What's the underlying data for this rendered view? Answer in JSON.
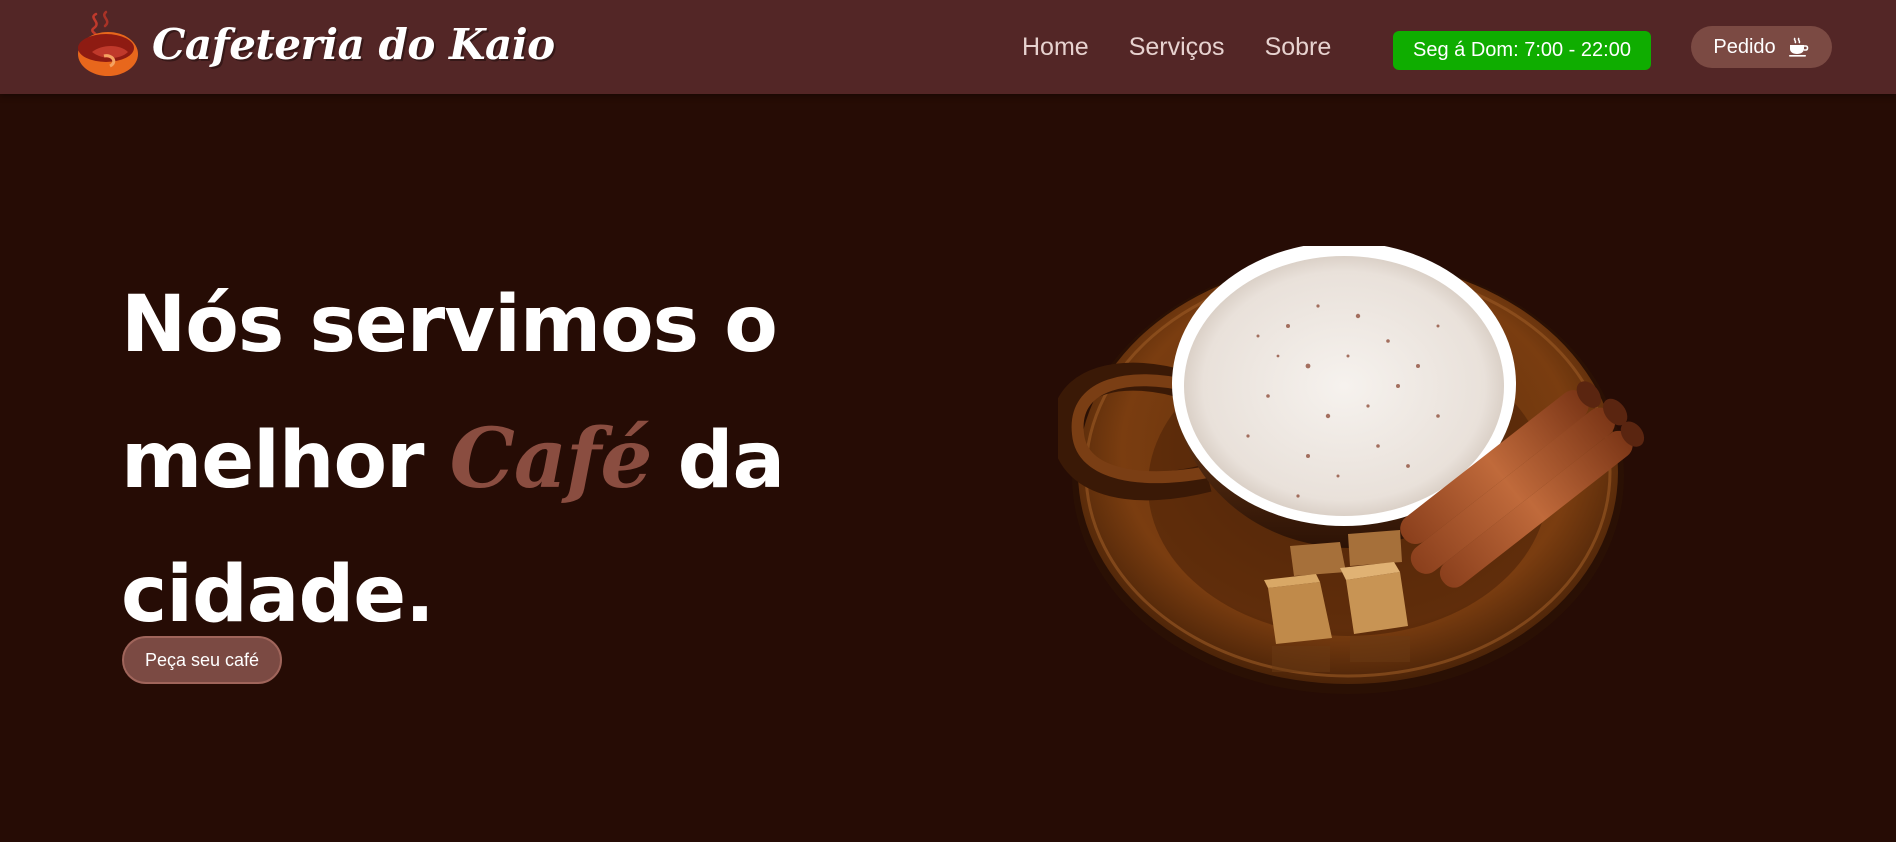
{
  "navbar": {
    "brand": "Cafeteria do Kaio",
    "links": [
      "Home",
      "Serviços",
      "Sobre"
    ],
    "hours": "Seg á Dom: 7:00 - 22:00",
    "order_label": "Pedido",
    "order_icon": "coffee-cup-icon"
  },
  "hero": {
    "title_line1": "Nós servimos o",
    "title_line2_pre": "melhor ",
    "title_line2_accent": "Café",
    "title_line2_post": " da",
    "title_line3": "cidade.",
    "cta_label": "Peça seu café"
  },
  "colors": {
    "navbar_bg": "#532626",
    "page_bg": "#260c05",
    "accent": "#8a4d40",
    "button_bg": "#7b4a43",
    "hours_badge_bg": "#0fad00"
  }
}
